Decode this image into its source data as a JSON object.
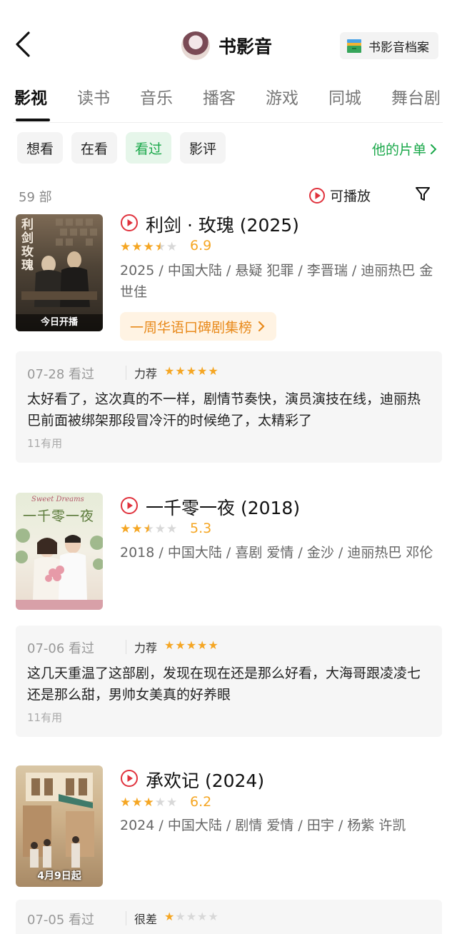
{
  "header": {
    "title": "书影音",
    "archive_label": "书影音档案"
  },
  "tabs": [
    {
      "label": "影视",
      "active": true
    },
    {
      "label": "读书",
      "active": false
    },
    {
      "label": "音乐",
      "active": false
    },
    {
      "label": "播客",
      "active": false
    },
    {
      "label": "游戏",
      "active": false
    },
    {
      "label": "同城",
      "active": false
    },
    {
      "label": "舞台剧",
      "active": false
    }
  ],
  "filters": [
    {
      "label": "想看",
      "active": false
    },
    {
      "label": "在看",
      "active": false
    },
    {
      "label": "看过",
      "active": true
    },
    {
      "label": "影评",
      "active": false
    }
  ],
  "his_list_label": "他的片单",
  "count_label": "59 部",
  "playable_label": "可播放",
  "colors": {
    "accent_green": "#1aa84a",
    "star": "#f5a623",
    "play_red": "#e0313c"
  },
  "items": [
    {
      "title": "利剑 · 玫瑰 (2025)",
      "poster_text": "利剑玫瑰",
      "poster_badge": "今日开播",
      "stars": 3.5,
      "rating": "6.9",
      "meta": "2025 / 中国大陆 / 悬疑 犯罪 / 李晋瑞 / 迪丽热巴 金世佳",
      "rank_tag": "一周华语口碑剧集榜",
      "review": {
        "date": "07-28 看过",
        "label": "力荐",
        "stars": 5,
        "text": "太好看了，这次真的不一样，剧情节奏快，演员演技在线，迪丽热巴前面被绑架那段冒冷汗的时候绝了，太精彩了",
        "useful": "11有用"
      }
    },
    {
      "title": "一千零一夜 (2018)",
      "poster_text": "一千零一夜",
      "poster_subtitle": "Sweet Dreams",
      "stars": 2.5,
      "rating": "5.3",
      "meta": "2018 / 中国大陆 / 喜剧 爱情 / 金沙 / 迪丽热巴 邓伦",
      "review": {
        "date": "07-06 看过",
        "label": "力荐",
        "stars": 5,
        "text": "这几天重温了这部剧，发现在现在还是那么好看，大海哥跟凌凌七还是那么甜，男帅女美真的好养眼",
        "useful": "11有用"
      }
    },
    {
      "title": "承欢记 (2024)",
      "poster_badge": "4月9日起",
      "stars": 3,
      "rating": "6.2",
      "meta": "2024 / 中国大陆 / 剧情 爱情 / 田宇 / 杨紫 许凯",
      "review": {
        "date": "07-05 看过",
        "label": "很差",
        "stars": 1
      }
    }
  ]
}
